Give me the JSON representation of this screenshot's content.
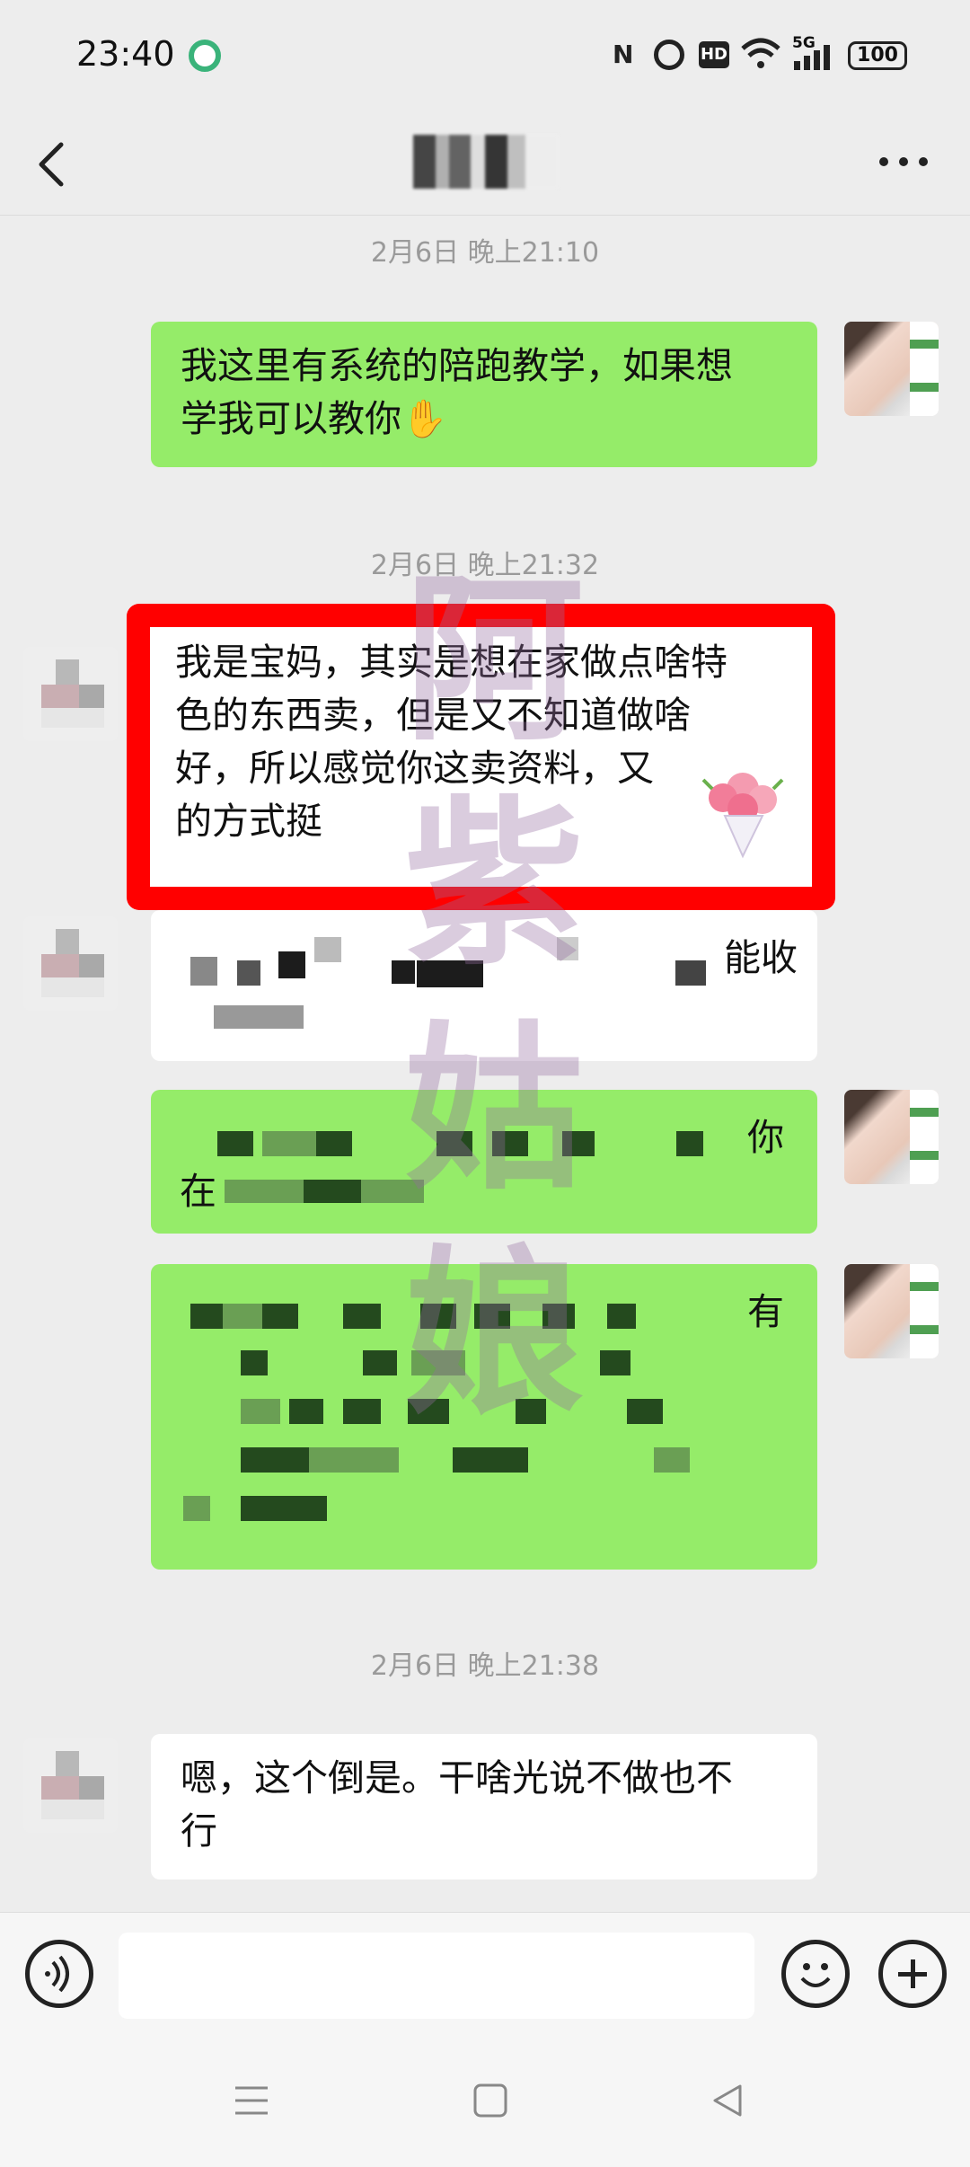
{
  "status_bar": {
    "time": "23:40",
    "icons": [
      "nfc-icon",
      "alarm-icon",
      "hd-icon",
      "wifi-icon",
      "5g-signal-icon"
    ],
    "network": "5G",
    "hd": "HD",
    "battery": "100"
  },
  "header": {
    "back_icon": "chevron-left-icon",
    "more_icon": "more-icon"
  },
  "messages": [
    {
      "type": "timestamp",
      "text": "2月6日 晚上21:10"
    },
    {
      "type": "sent",
      "text": "我这里有系统的陪跑教学，如果想学我可以教你"
    },
    {
      "type": "timestamp",
      "text": "2月6日 晚上21:32"
    },
    {
      "type": "received",
      "text": "我是宝妈，其实是想在家做点啥特色的东西卖，但是又不知道做啥好，所以感觉你这卖资料，又的方式挺"
    },
    {
      "type": "received",
      "text_visible": "能收",
      "blurred": true
    },
    {
      "type": "sent",
      "text_visible": "你 在",
      "blurred": true
    },
    {
      "type": "sent",
      "text_visible": "有",
      "blurred": true
    },
    {
      "type": "timestamp",
      "text": "2月6日 晚上21:38"
    },
    {
      "type": "received",
      "text": "嗯，这个倒是。干啥光说不做也不行"
    }
  ],
  "redbox_lines": [
    "我是宝妈，其实是想在家做点啥特",
    "色的东西卖，但是又不知道做啥",
    "好，所以感觉你这卖资料，又",
    "的方式挺"
  ],
  "sent1_lines": [
    "我这里有系统的陪跑教学，如果想",
    "学我可以教你"
  ],
  "received_last_lines": [
    "嗯，这个倒是。干啥光说不做也不",
    "行"
  ],
  "blur_fragments": {
    "a": "能收",
    "b": "你",
    "c": "在",
    "d": "有"
  },
  "watermark": "阿紫姑娘",
  "colors": {
    "sent_bubble": "#95ec69",
    "received_bubble": "#ffffff",
    "highlight": "#ff0000",
    "background": "#ededed"
  }
}
